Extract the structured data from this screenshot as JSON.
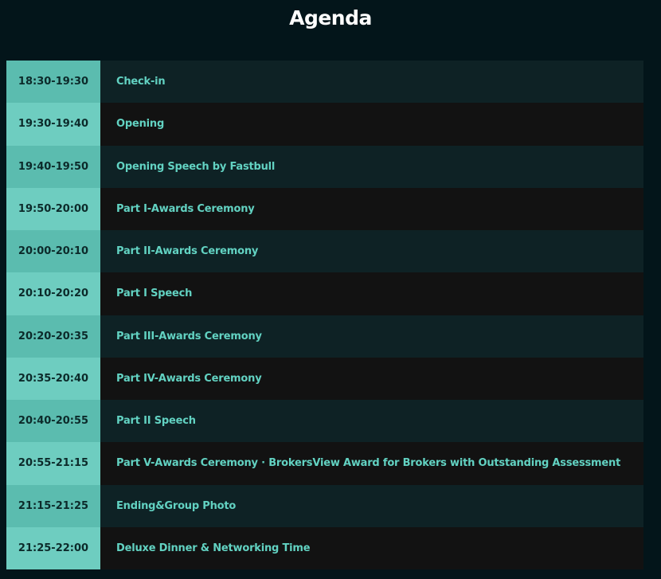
{
  "header": {
    "title": "Agenda"
  },
  "agenda": {
    "rows": [
      {
        "time": "18:30-19:30",
        "event": "Check-in"
      },
      {
        "time": "19:30-19:40",
        "event": "Opening"
      },
      {
        "time": "19:40-19:50",
        "event": "Opening Speech by Fastbull"
      },
      {
        "time": "19:50-20:00",
        "event": "Part I-Awards Ceremony"
      },
      {
        "time": "20:00-20:10",
        "event": "Part II-Awards Ceremony"
      },
      {
        "time": "20:10-20:20",
        "event": "Part I Speech"
      },
      {
        "time": "20:20-20:35",
        "event": "Part III-Awards Ceremony"
      },
      {
        "time": "20:35-20:40",
        "event": "Part IV-Awards Ceremony"
      },
      {
        "time": "20:40-20:55",
        "event": "Part II Speech"
      },
      {
        "time": "20:55-21:15",
        "event": "Part V-Awards Ceremony · BrokersView Award for Brokers with Outstanding Assessment"
      },
      {
        "time": "21:15-21:25",
        "event": "Ending&Group Photo"
      },
      {
        "time": "21:25-22:00",
        "event": "Deluxe Dinner & Networking Time"
      }
    ]
  },
  "colors": {
    "page_background": "#03151a",
    "time_cell_dark": "#5bbcaf",
    "time_cell_light": "#6ecdc0",
    "event_text": "#62d2c2",
    "row_dark_teal": "#0e2225",
    "row_black": "#121212"
  }
}
